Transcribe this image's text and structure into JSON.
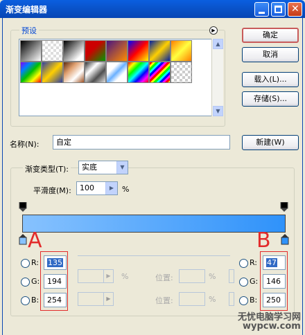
{
  "window": {
    "title": "渐变编辑器"
  },
  "presets": {
    "label": "预设",
    "swatch_count": 18
  },
  "buttons": {
    "ok": "确定",
    "cancel": "取消",
    "load": "载入(L)...",
    "save": "存储(S)...",
    "new": "新建(W)"
  },
  "name_field": {
    "label": "名称(N):",
    "value": "自定"
  },
  "gradient": {
    "type_label": "渐变类型(T):",
    "type_value": "实底",
    "smoothness_label": "平滑度(M):",
    "smoothness_value": "100",
    "smoothness_unit": "%",
    "start_color": "#87c2fe",
    "end_color": "#2f92fa"
  },
  "left_stop": {
    "marker": "A",
    "r_label": "R:",
    "r_value": "135",
    "g_label": "G:",
    "g_value": "194",
    "b_label": "B:",
    "b_value": "254"
  },
  "right_stop": {
    "marker": "B",
    "r_label": "R:",
    "r_value": "47",
    "g_label": "G:",
    "g_value": "146",
    "b_label": "B:",
    "b_value": "250"
  },
  "stops_panel": {
    "opacity_unit": "%",
    "position_label": "位置:",
    "position_unit": "%"
  },
  "watermark": {
    "line1": "无忧电脑学习网",
    "line2": "wypcw.com"
  },
  "colors": {
    "accent": "#0a5fe0",
    "annotation_red": "#e22b2b"
  }
}
